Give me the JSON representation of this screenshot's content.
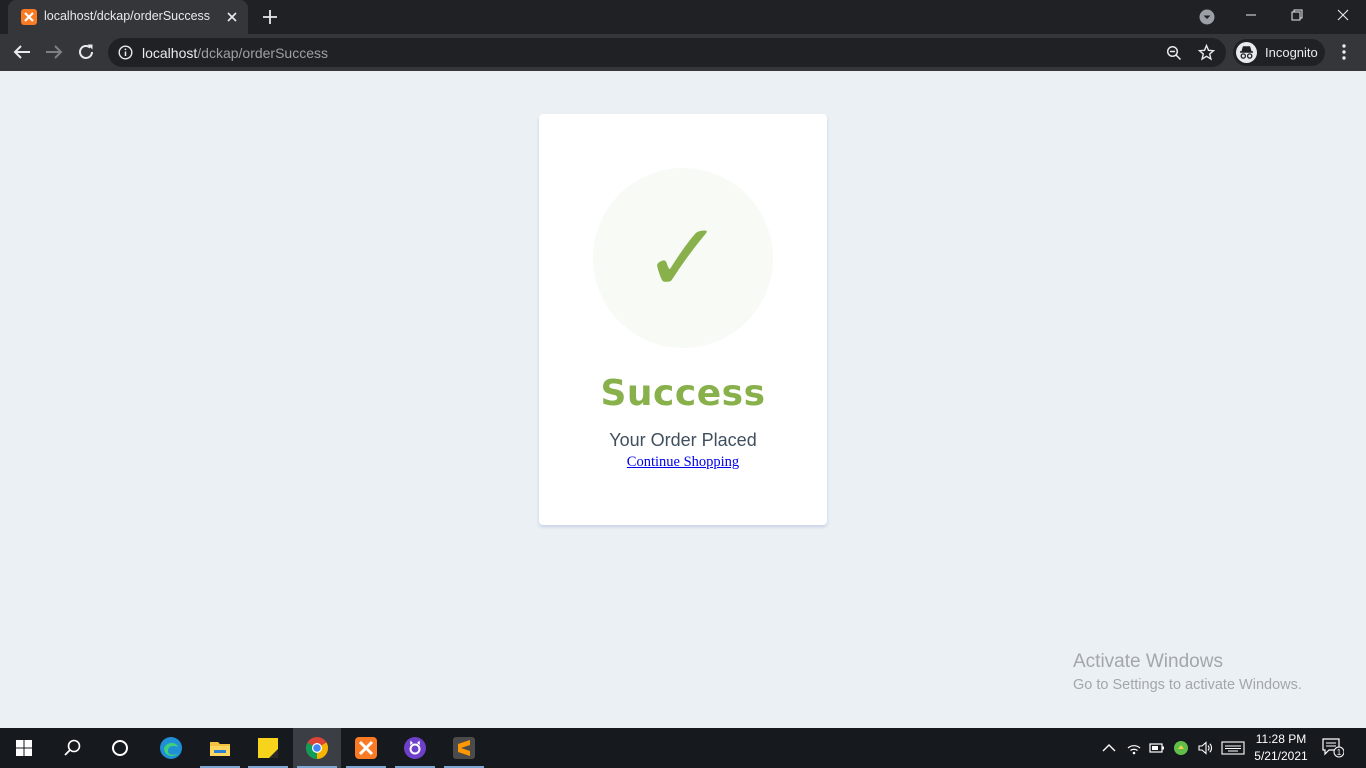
{
  "browser": {
    "tab_title": "localhost/dckap/orderSuccess",
    "url_host": "localhost",
    "url_path": "/dckap/orderSuccess",
    "profile_label": "Incognito"
  },
  "card": {
    "check_symbol": "✓",
    "title": "Success",
    "message": "Your Order Placed",
    "link_label": "Continue Shopping"
  },
  "watermark": {
    "title": "Activate Windows",
    "subtitle": "Go to Settings to activate Windows."
  },
  "taskbar": {
    "time": "11:28 PM",
    "date": "5/21/2021",
    "notification_count": "1",
    "apps": [
      "start-icon",
      "search-icon",
      "cortana-icon",
      "edge-icon",
      "file-explorer-icon",
      "sticky-notes-icon",
      "chrome-icon",
      "xampp-icon",
      "github-desktop-icon",
      "sublime-text-icon"
    ]
  },
  "colors": {
    "accent_green": "#88b04b",
    "page_bg": "#ebf0f4",
    "text_dark": "#404f5e",
    "link_blue": "#0000ee"
  }
}
